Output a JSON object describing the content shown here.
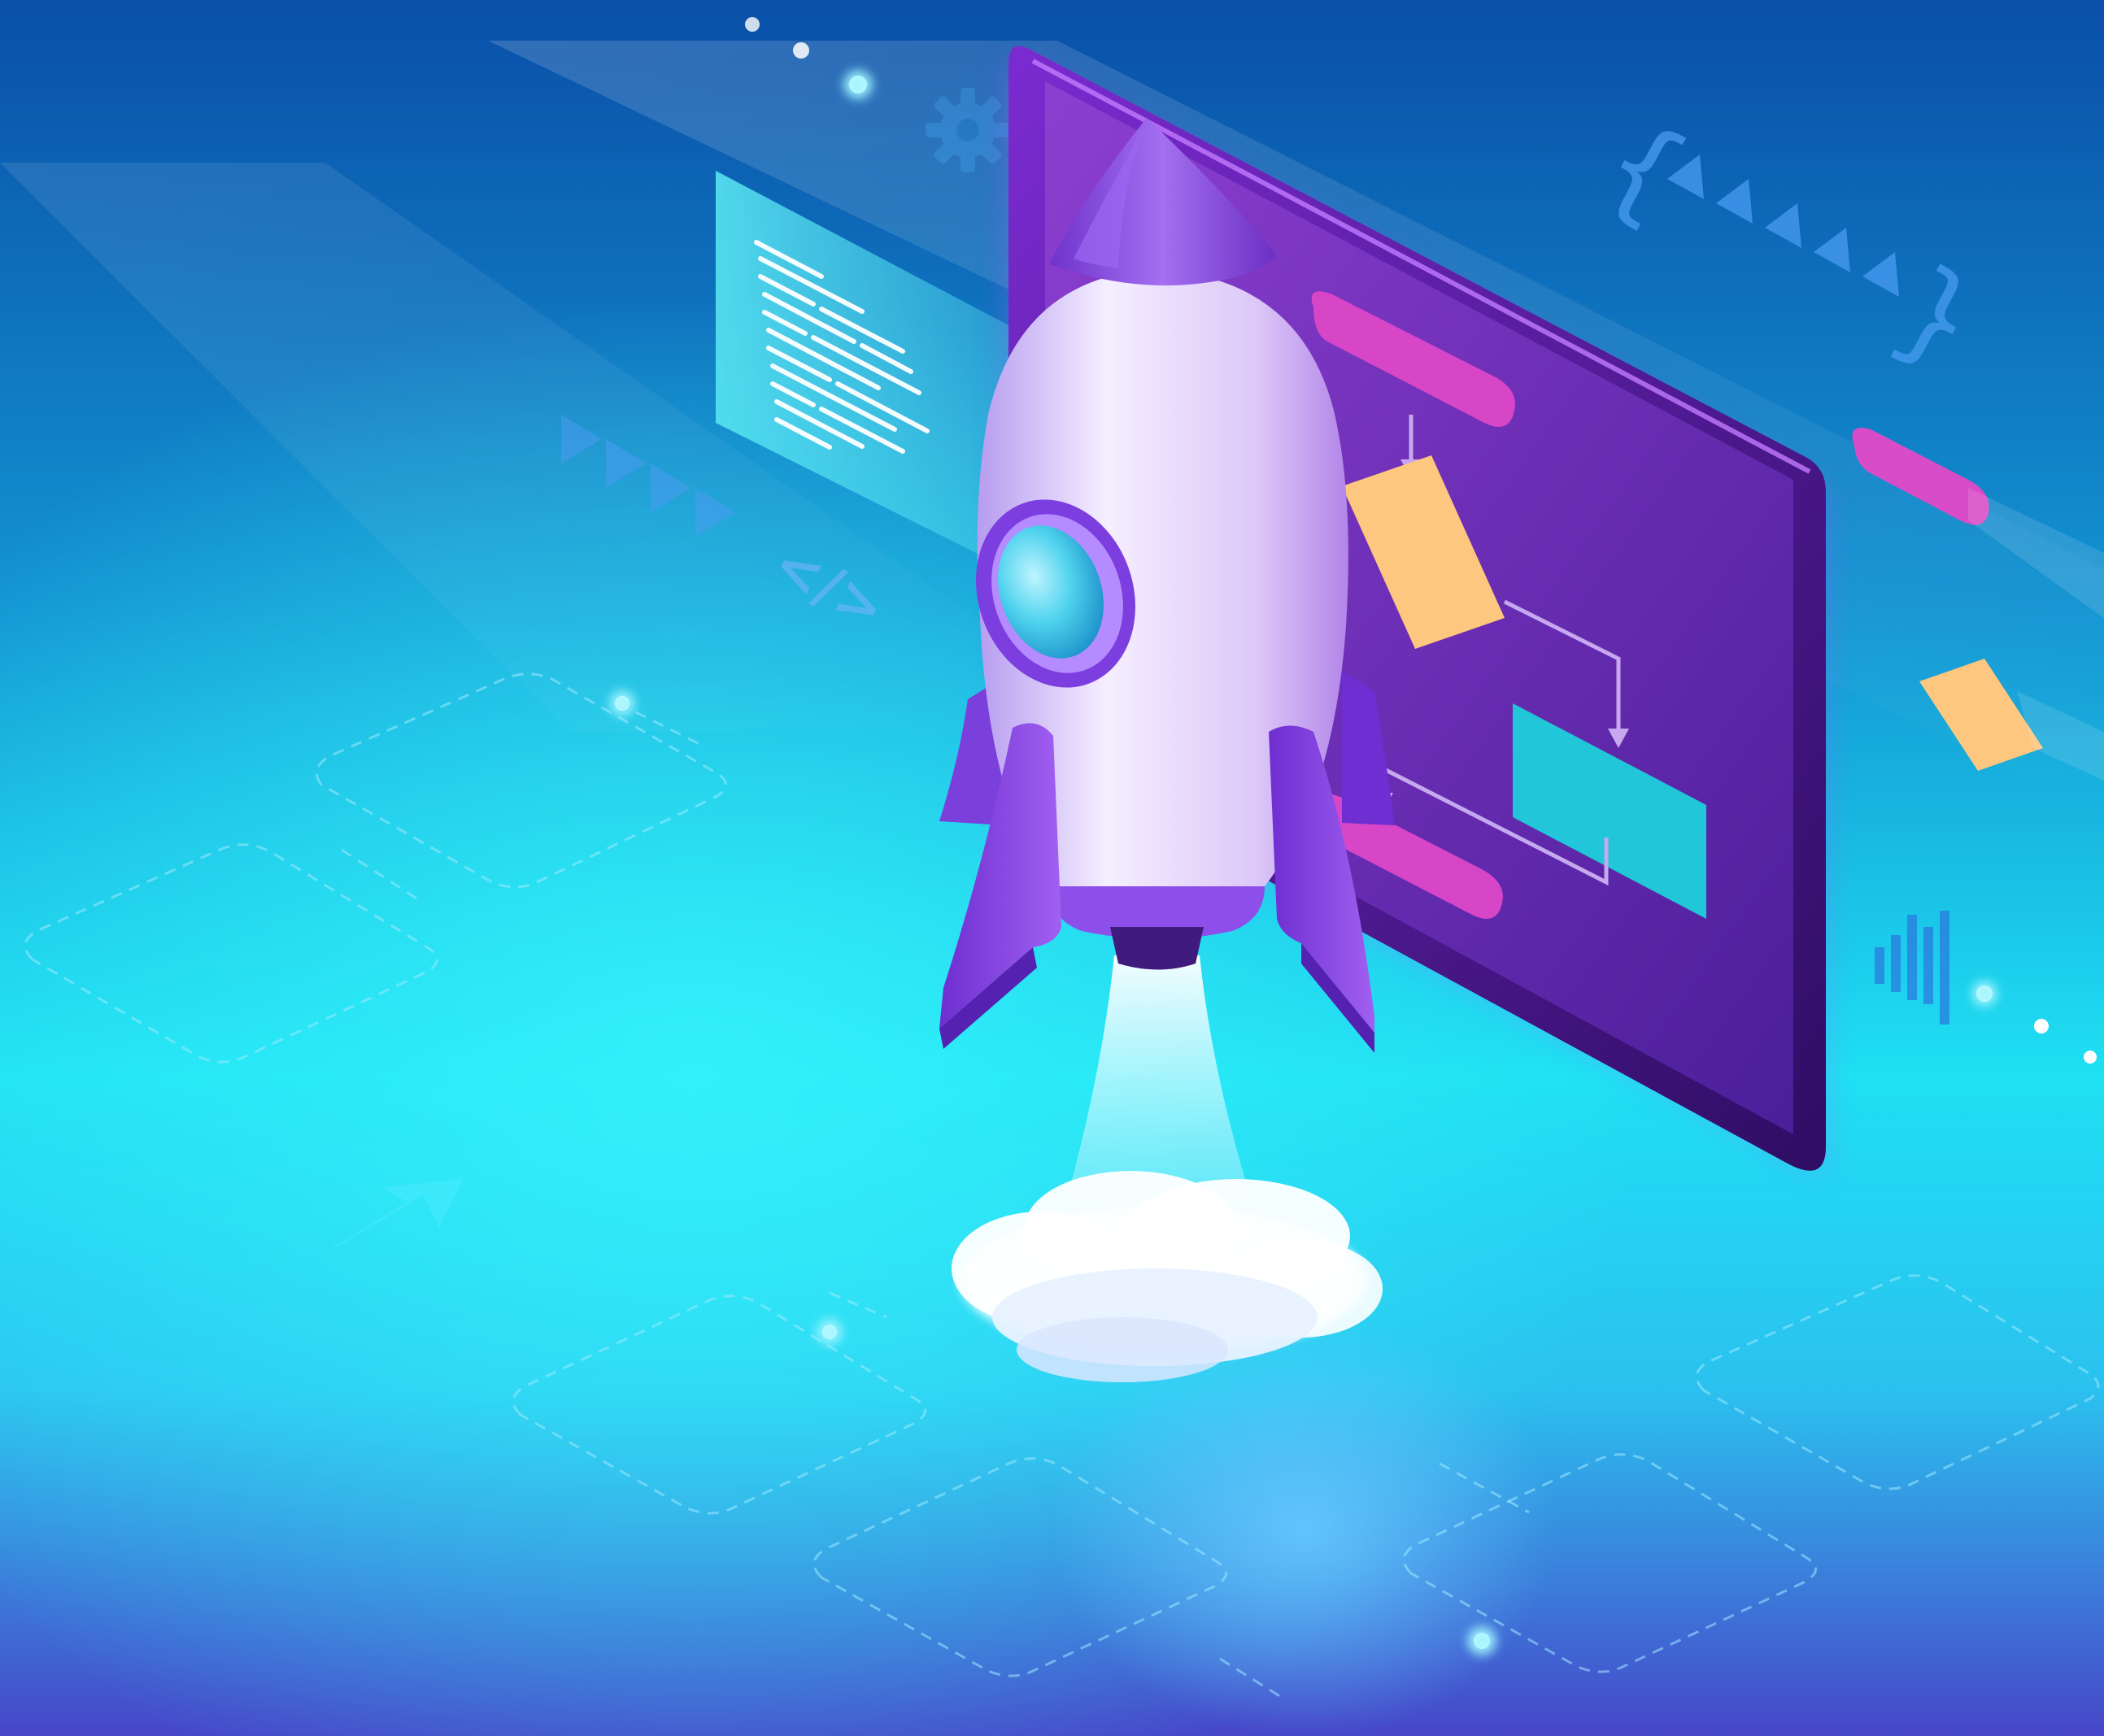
{
  "scene": {
    "code_symbol": "</>",
    "left_brace": "{",
    "right_brace": "}",
    "colors": {
      "bg_top": "#0a56b0",
      "bg_mid": "#14b7df",
      "bg_glow": "#22e9f5",
      "bg_bottom": "#3e4ecd",
      "tablet_frame": "#4d1b86",
      "tablet_screen": "#6b2fbb",
      "pill_magenta": "#d846c8",
      "flow_peach": "#fdc77f",
      "flow_teal": "#21c6d8",
      "rocket_body": "#ede3ff",
      "rocket_purple": "#8a4be6",
      "porthole_glass": "#58d6ef",
      "smoke": "#ffffff"
    }
  }
}
